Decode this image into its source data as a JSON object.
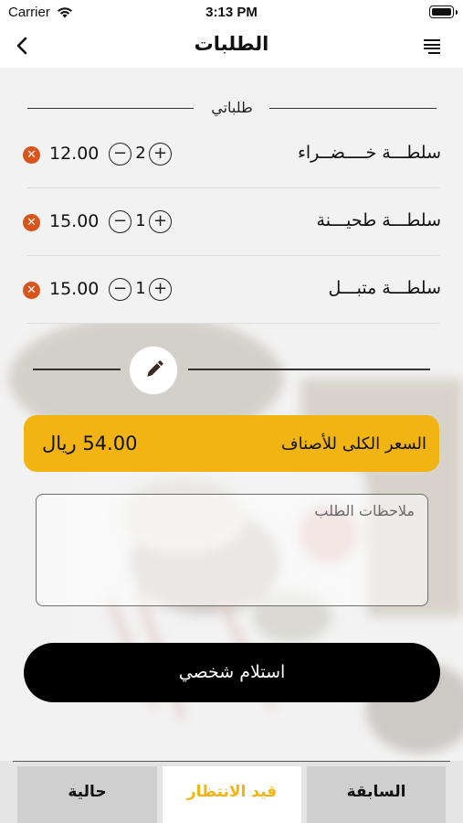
{
  "status_bar": {
    "carrier": "Carrier",
    "time": "3:13 PM"
  },
  "navbar": {
    "title": "الطلبات",
    "back_icon": "chevron-left-icon",
    "menu_icon": "list-icon"
  },
  "section": {
    "title": "طلباتي"
  },
  "items": [
    {
      "name": "سلطـــة خــــضــراء",
      "price": "12.00",
      "quantity": "2"
    },
    {
      "name": "سلطـــة طحيـــنة",
      "price": "15.00",
      "quantity": "1"
    },
    {
      "name": "سلطـــة متبـــل",
      "price": "15.00",
      "quantity": "1"
    }
  ],
  "controls": {
    "minus": "−",
    "plus": "+",
    "remove": "✕"
  },
  "total": {
    "label": "السعر الكلى للأصناف",
    "amount": "54.00 ريال"
  },
  "notes": {
    "placeholder": "ملاحظات الطلب",
    "value": ""
  },
  "pickup_button": {
    "label": "استلام شخصي"
  },
  "tabs": [
    {
      "label": "حالية",
      "active": false
    },
    {
      "label": "قيد الانتظار",
      "active": true
    },
    {
      "label": "السابقة",
      "active": false
    }
  ],
  "colors": {
    "accent": "#f2b413",
    "remove": "#d8541c",
    "button": "#000000"
  }
}
